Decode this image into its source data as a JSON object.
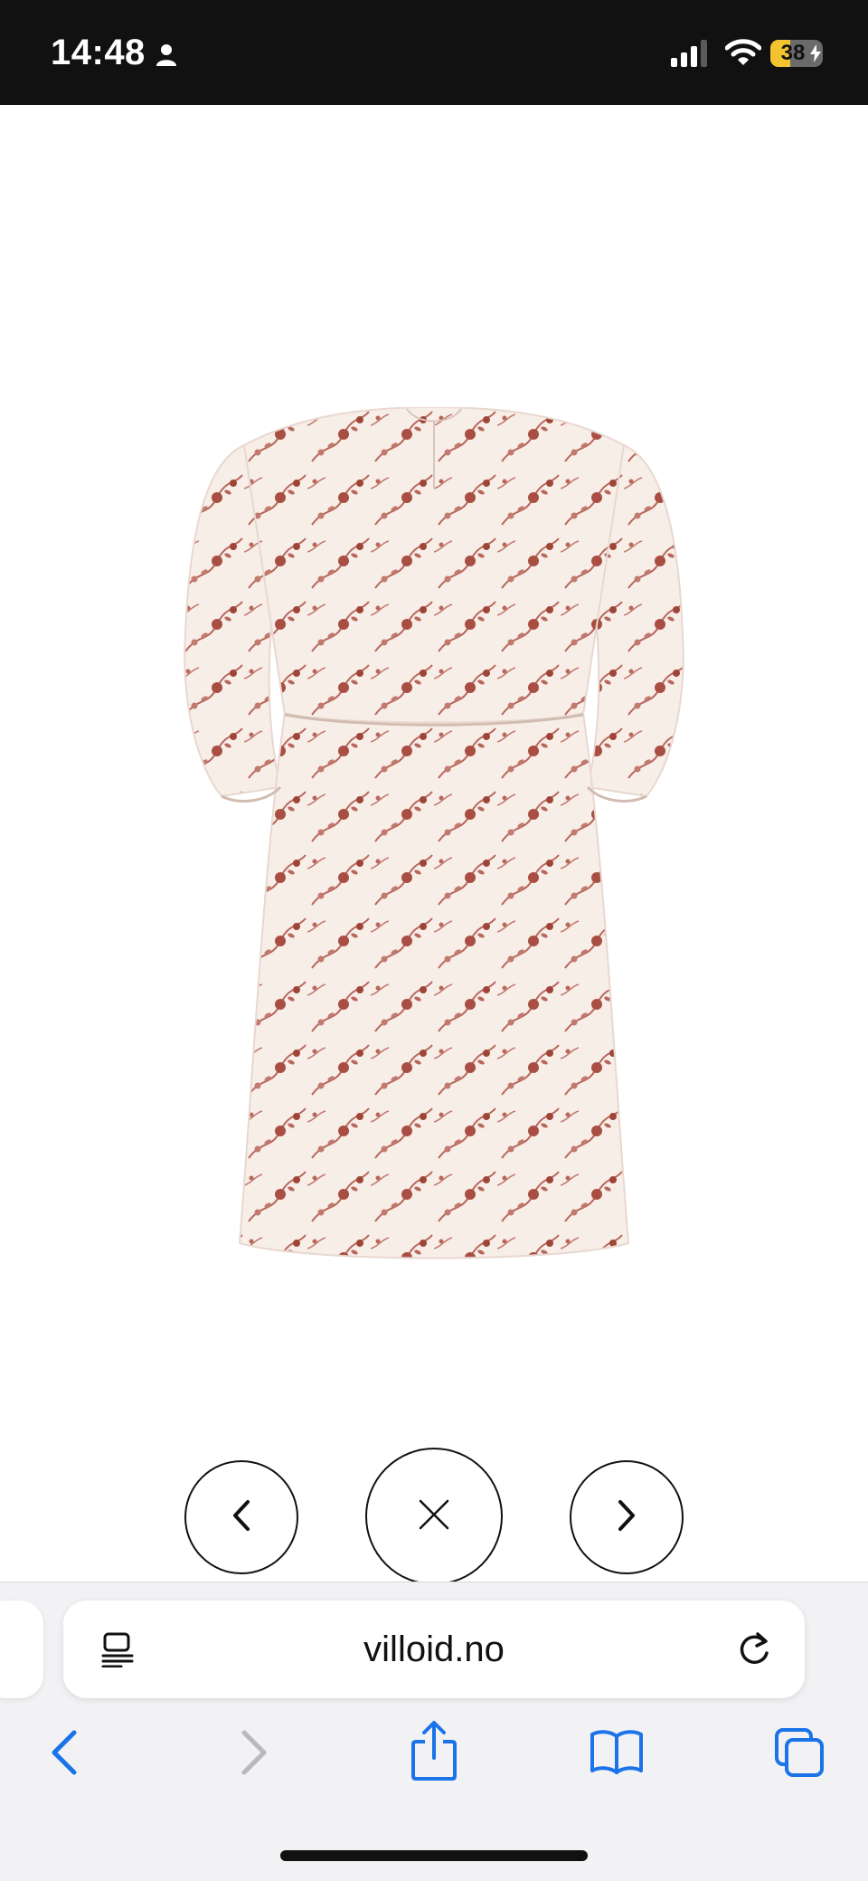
{
  "status_bar": {
    "time": "14:48",
    "battery_level": "38",
    "battery_fraction": 0.38
  },
  "gallery": {
    "image_alt": "Floral print long-sleeve dress, back view",
    "controls": {
      "prev_icon": "chevron-left-icon",
      "close_icon": "close-icon",
      "next_icon": "chevron-right-icon"
    }
  },
  "browser": {
    "url": "villoid.no",
    "icons": [
      "reader-icon",
      "reload-icon",
      "back-icon",
      "forward-icon",
      "share-icon",
      "bookmarks-icon",
      "tabs-icon"
    ],
    "accent_color": "#1a73e8",
    "disabled_color": "#b8b8bd"
  },
  "colors": {
    "status_bar_bg": "#111111",
    "battery_fill": "#f4c430",
    "dress_base": "#f8eee8",
    "floral_print": "#a94e42"
  }
}
